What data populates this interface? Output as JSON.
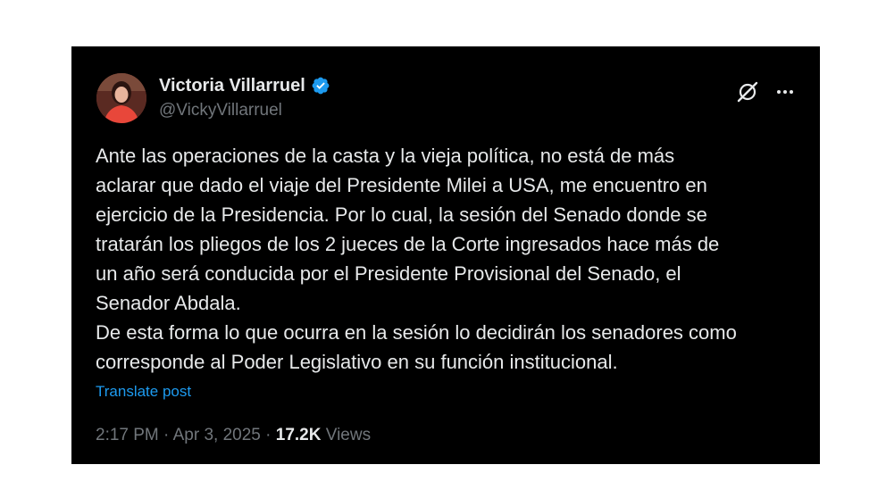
{
  "author": {
    "display_name": "Victoria Villarruel",
    "handle": "@VickyVillarruel",
    "verified_badge_color": "#1d9bf0"
  },
  "icons": {
    "grok": "grok-icon",
    "more": "more-options-icon",
    "verified": "verified-badge-icon"
  },
  "tweet": {
    "text": "Ante las operaciones de la casta y la vieja política, no está de más\naclarar que dado el viaje del Presidente Milei a USA, me encuentro en\nejercicio de la Presidencia. Por lo cual, la sesión del Senado donde se\ntratarán los pliegos de los 2 jueces de la Corte ingresados hace más de\nun año será conducida por el Presidente Provisional del Senado, el\nSenador Abdala.\nDe esta forma lo que ocurra en la sesión lo decidirán los senadores como\ncorresponde al Poder Legislativo en su función institucional.",
    "translate_label": "Translate post",
    "time": "2:17 PM",
    "separator": "·",
    "date": "Apr 3, 2025",
    "views_count": "17.2K",
    "views_label": "Views"
  },
  "colors": {
    "background": "#000000",
    "text": "#e7e9ea",
    "secondary": "#71767b",
    "link": "#1d9bf0"
  }
}
